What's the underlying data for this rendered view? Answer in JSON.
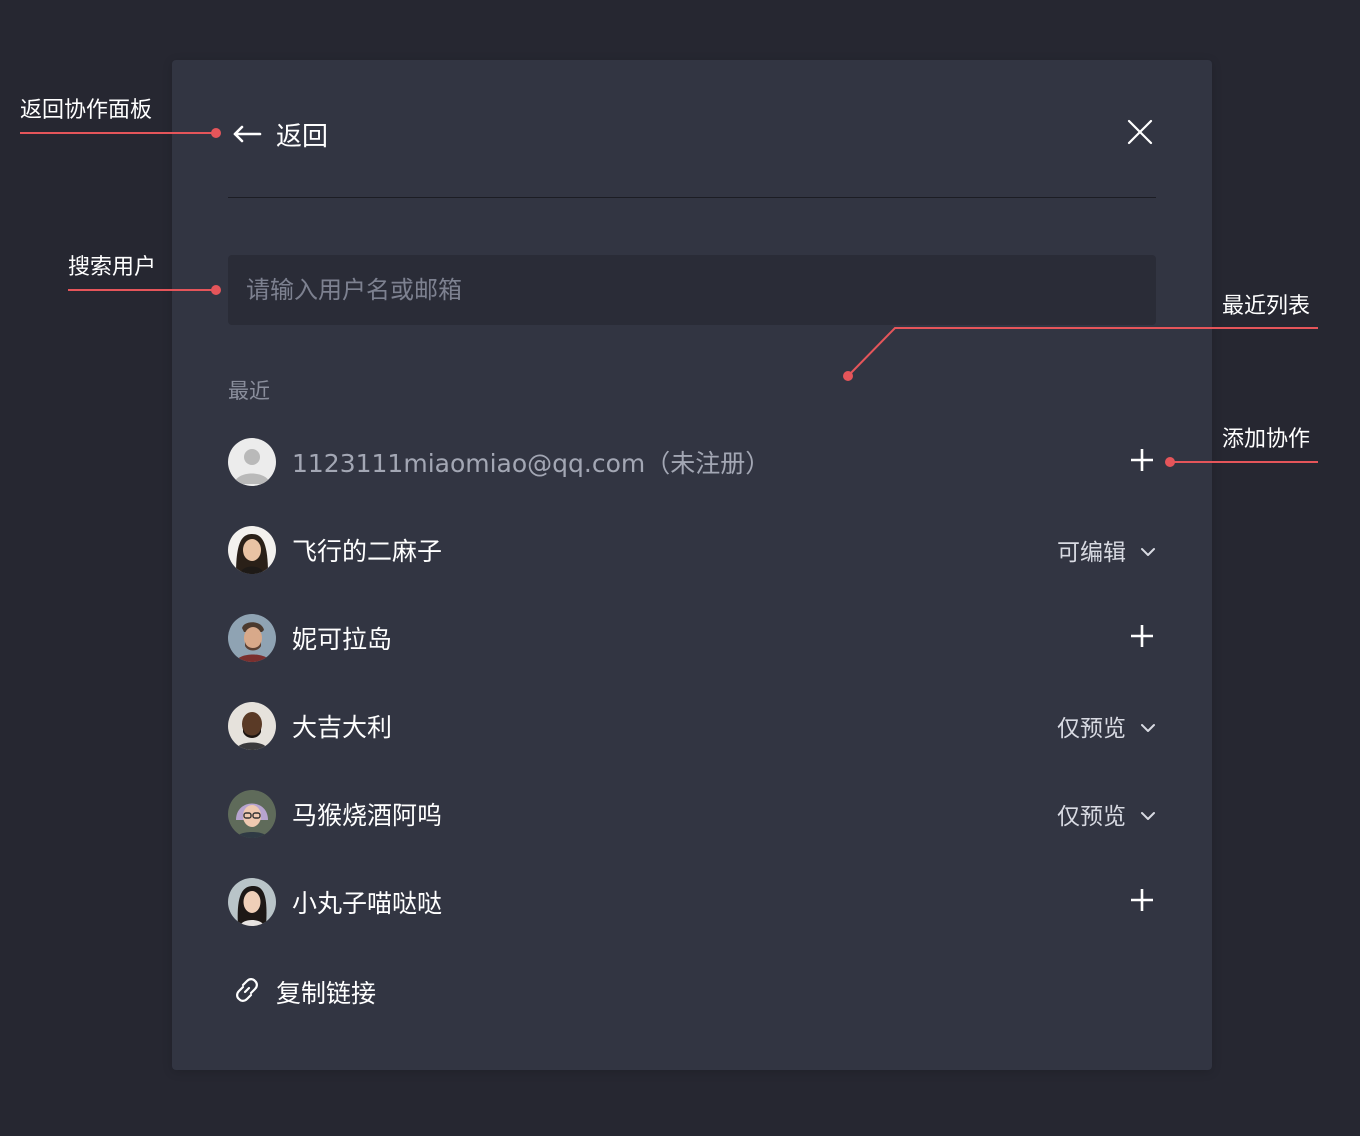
{
  "header": {
    "back_label": "返回"
  },
  "search": {
    "placeholder": "请输入用户名或邮箱",
    "value": ""
  },
  "recent": {
    "label": "最近",
    "users": [
      {
        "name": "1123111miaomiao@qq.com（未注册）",
        "action": "add"
      },
      {
        "name": "飞行的二麻子",
        "action": "permission",
        "permission": "可编辑"
      },
      {
        "name": "妮可拉岛",
        "action": "add"
      },
      {
        "name": "大吉大利",
        "action": "permission",
        "permission": "仅预览"
      },
      {
        "name": "马猴烧酒阿呜",
        "action": "permission",
        "permission": "仅预览"
      },
      {
        "name": "小丸子喵哒哒",
        "action": "add"
      }
    ]
  },
  "footer": {
    "copy_link_label": "复制链接"
  },
  "annotations": {
    "back_panel": "返回协作面板",
    "search_user": "搜索用户",
    "recent_list": "最近列表",
    "add_collab": "添加协作"
  },
  "colors": {
    "page_bg": "#262731",
    "panel_bg": "#323542",
    "annotation": "#e5555a",
    "text_primary": "#ffffff",
    "text_muted": "#a3a7b4"
  }
}
